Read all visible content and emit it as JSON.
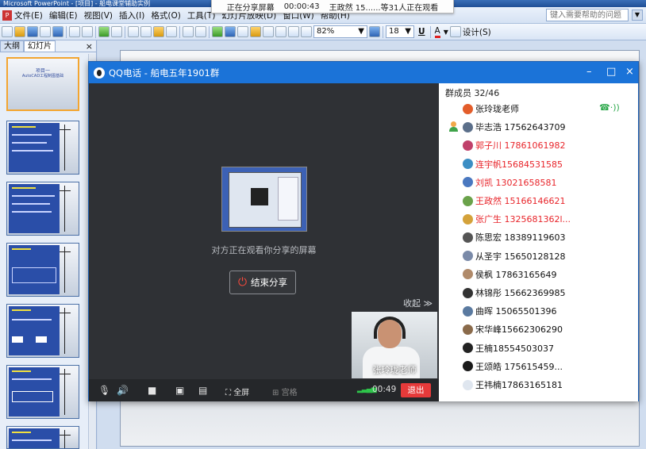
{
  "app": {
    "title_fragment": "Microsoft PowerPoint - [项目] - 船电课堂辅助实例",
    "menus": [
      "文件(E)",
      "编辑(E)",
      "视图(V)",
      "插入(I)",
      "格式(O)",
      "工具(T)",
      "幻灯片放映(D)",
      "窗口(W)",
      "帮助(H)"
    ],
    "help_placeholder": "键入需要帮助的问题",
    "zoom": "82%",
    "font_size": "18",
    "design_label": "设计(S)"
  },
  "share_bar": {
    "status": "正在分享屏幕",
    "elapsed": "00:00:43",
    "viewers": "王政然 15......等31人正在观看"
  },
  "pane": {
    "tabs": [
      "大纲",
      "幻灯片"
    ],
    "close": "×",
    "first_slide_title": "项目一",
    "first_slide_subtitle": "AutoCAD工程制图基础"
  },
  "qq": {
    "title": "QQ电话 - 船电五年1901群",
    "controls": {
      "minimize": "–",
      "maximize": "□",
      "close": "×"
    },
    "share_info": "对方正在观看你分享的屏幕",
    "end_share_label": "结束分享",
    "collapse_label": "收起 ≫",
    "camera_name": "张玲珑老师",
    "fullscreen_label": "全屏",
    "grid_label": "宫格",
    "call_time": "00:49",
    "exit_label": "退出",
    "member_count": "群成员 32/46",
    "members": [
      {
        "name": "张玲珑老师",
        "red": false,
        "color": "#e35d2a"
      },
      {
        "name": "毕志浩 17562643709",
        "red": false,
        "color": "#5b6f8a"
      },
      {
        "name": "郭子川 17861061982",
        "red": true,
        "color": "#c0406a"
      },
      {
        "name": "连宇帆15684531585",
        "red": true,
        "color": "#3c8ec4"
      },
      {
        "name": "刘凯  13021658581",
        "red": true,
        "color": "#4a78c0"
      },
      {
        "name": "王政然 15166146621",
        "red": true,
        "color": "#6aa24a"
      },
      {
        "name": "张广生    1325681362l...",
        "red": true,
        "color": "#d4a23a"
      },
      {
        "name": "陈思宏 18389119603",
        "red": false,
        "color": "#555"
      },
      {
        "name": "从圣宇 15650128128",
        "red": false,
        "color": "#7a8aa8"
      },
      {
        "name": "侯枫  17863165649",
        "red": false,
        "color": "#b08a6a"
      },
      {
        "name": "林锦彤 15662369985",
        "red": false,
        "color": "#333"
      },
      {
        "name": "曲晖  15065501396",
        "red": false,
        "color": "#5a7aa0"
      },
      {
        "name": "宋华峰15662306290",
        "red": false,
        "color": "#8a6a4a"
      },
      {
        "name": "王楠18554503037",
        "red": false,
        "color": "#222"
      },
      {
        "name": "王颂皓     175615459...",
        "red": false,
        "color": "#1a1a1a"
      },
      {
        "name": "王祎楠17863165181",
        "red": false,
        "color": "#dfe6ef"
      }
    ]
  }
}
